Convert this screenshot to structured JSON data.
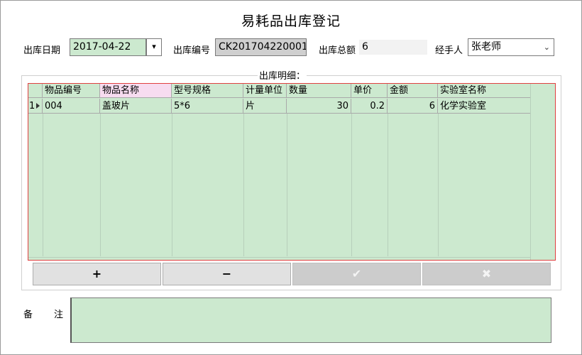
{
  "window": {
    "title": "易耗品出库登记"
  },
  "header": {
    "date_label": "出库日期",
    "date_value": "2017-04-22",
    "date_dropdown_glyph": "▾",
    "code_label": "出库编号",
    "code_value": "CK201704220001",
    "total_label": "出库总额",
    "total_value": "6",
    "handler_label": "经手人",
    "handler_value": "张老师"
  },
  "detail": {
    "legend": "出库明细：",
    "columns": [
      "物品编号",
      "物品名称",
      "型号规格",
      "计量单位",
      "数量",
      "单价",
      "金额",
      "实验室名称"
    ],
    "rows": [
      {
        "row_no": "1",
        "item_code": "004",
        "item_name": "盖玻片",
        "spec": "5*6",
        "unit": "片",
        "qty": "30",
        "price": "0.2",
        "amount": "6",
        "lab": "化学实验室"
      }
    ]
  },
  "buttons": {
    "add": "+",
    "remove": "−",
    "confirm": "✔",
    "cancel": "✖"
  },
  "remark": {
    "label_1": "备",
    "label_2": "注",
    "value": ""
  },
  "colors": {
    "field_green": "#cce9cf",
    "grid_border": "#e04040",
    "header_pink": "#f7dcf0"
  }
}
